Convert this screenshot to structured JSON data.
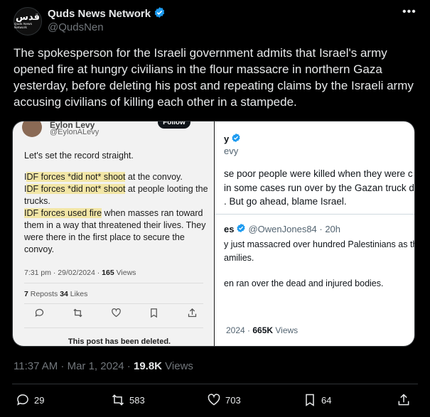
{
  "author": {
    "name": "Quds News Network",
    "handle": "@QudsNen",
    "avatar_text": "قدس",
    "avatar_sub": "Quds News Network"
  },
  "tweet": {
    "text": "The spokesperson for the Israeli government admits that Israel's army opened fire at hungry civilians in the flour massacre in northern Gaza yesterday, before deleting his post and repeating claims by the Israeli army accusing civilians of killing each other in a stampede."
  },
  "media": {
    "left": {
      "name": "Eylon Levy",
      "handle": "@EylonALevy",
      "follow": "Follow",
      "line1": "Let's set the record straight.",
      "p1_pre": "I",
      "p1_hl": "DF forces *did not* shoot",
      "p1_post": " at the convoy.",
      "p2_pre": "I",
      "p2_hl": "DF forces *did not* shoot",
      "p2_post": " at people looting the trucks.",
      "p3_hl": "IDF forces used fire",
      "p3_post": " when masses ran toward them in a way that threatened their lives. They were there in the first place to secure the convoy.",
      "timestamp": "7:31 pm · 29/02/2024 · ",
      "views_num": "165",
      "views_label": " Views",
      "reposts_num": "7",
      "reposts_label": " Reposts  ",
      "likes_num": "34",
      "likes_label": " Likes",
      "deleted": "This post has been deleted."
    },
    "right": {
      "name": "y",
      "handle": "evy",
      "text1": "se poor people were killed when they were c\nin some cases run over by the Gazan truck d\n. But go ahead, blame Israel.",
      "name2": "es",
      "handle2": "@OwenJones84 · 20h",
      "text2_1": "y just massacred over hundred Palestinians as they",
      "text2_2": "amilies.",
      "text2_3": "en ran over the dead and injured bodies.",
      "meta_pre": "2024 · ",
      "meta_views": "665K",
      "meta_label": " Views"
    }
  },
  "footer": {
    "time": "11:37 AM · Mar 1, 2024 · ",
    "views_num": "19.8K",
    "views_label": " Views"
  },
  "actions": {
    "replies": "29",
    "reposts": "583",
    "likes": "703",
    "bookmarks": "64"
  },
  "colors": {
    "verified": "#1d9bf0",
    "muted": "#71767b",
    "highlight": "#f2e6a6"
  }
}
